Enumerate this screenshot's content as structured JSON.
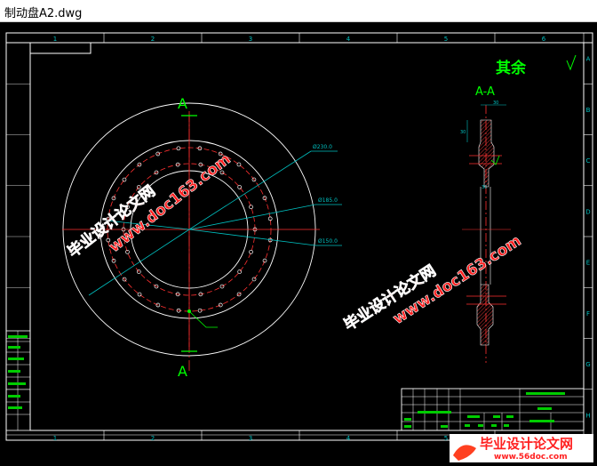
{
  "window": {
    "title": "制动盘A2.dwg"
  },
  "frame": {
    "col_labels": [
      "1",
      "2",
      "3",
      "4",
      "5",
      "6"
    ],
    "row_labels": [
      "A",
      "B",
      "C",
      "D",
      "E",
      "F",
      "G",
      "H"
    ]
  },
  "drawing": {
    "roughness_note": "其余",
    "section_label": "A-A",
    "cut_label": "A",
    "dims": {
      "d1": "Ø230.0",
      "d2": "Ø185.0",
      "d3": "Ø150.0",
      "w1": "30",
      "h1": "30",
      "w2": "30"
    }
  },
  "watermarks": {
    "url": "www.doc163.com",
    "cn": "毕业设计论文网",
    "logo_cn": "毕业设计论文网",
    "logo_url": "www.56doc.com"
  },
  "colors": {
    "frame": "#ffffff",
    "grid_text": "#00ffff",
    "center": "#ff3030",
    "annotation": "#00ff00",
    "watermark": "#ff2020",
    "leader": "#00c0c0"
  }
}
